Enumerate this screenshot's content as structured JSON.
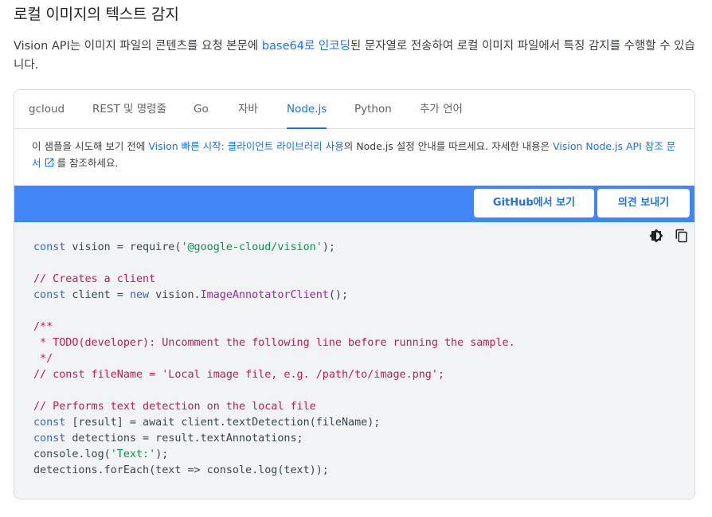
{
  "page": {
    "title": "로컬 이미지의 텍스트 감지",
    "intro": {
      "before": "Vision API는 이미지 파일의 콘텐츠를 요청 본문에 ",
      "link": "base64로 인코딩",
      "after": "된 문자열로 전송하여 로컬 이미지 파일에서 특징 감지를 수행할 수 있습니다."
    }
  },
  "tabs": [
    {
      "label": "gcloud",
      "active": false
    },
    {
      "label": "REST 및 명령줄",
      "active": false
    },
    {
      "label": "Go",
      "active": false
    },
    {
      "label": "자바",
      "active": false
    },
    {
      "label": "Node.js",
      "active": true
    },
    {
      "label": "Python",
      "active": false
    },
    {
      "label": "추가 언어",
      "active": false
    }
  ],
  "note": {
    "t1": "이 샘플을 시도해 보기 전에 ",
    "link1": "Vision 빠른 시작: 클라이언트 라이브러리 사용",
    "t2": "의 Node.js 설정 안내를 따르세요. 자세한 내용은 ",
    "link2": "Vision Node.js API 참조 문서",
    "t3": "를 참조하세요."
  },
  "buttons": {
    "github": "GitHub에서 보기",
    "feedback": "의견 보내기"
  },
  "code_tools": {
    "theme_icon": "dark-mode-toggle-icon",
    "copy_icon": "copy-icon"
  },
  "code": {
    "l1": [
      "const",
      " vision = require(",
      "'@google-cloud/vision'",
      ");"
    ],
    "l3": "// Creates a client",
    "l4": [
      "const",
      " client = ",
      "new",
      " vision.",
      "ImageAnnotatorClient",
      "();"
    ],
    "l6": "/**",
    "l7": " * TODO(developer): Uncomment the following line before running the sample.",
    "l8": " */",
    "l9": "// const fileName = 'Local image file, e.g. /path/to/image.png';",
    "l11": "// Performs text detection on the local file",
    "l12": [
      "const",
      " [result] = await client.textDetection(fileName);"
    ],
    "l13": [
      "const",
      " detections = result.textAnnotations;"
    ],
    "l14": [
      "console.log(",
      "'Text:'",
      ");"
    ],
    "l15": "detections.forEach(text => console.log(text));"
  },
  "colors": {
    "accent": "#1a73e8",
    "bar": "#4285f4",
    "code_bg": "#f1f3f4",
    "keyword": "#3367d6",
    "string": "#0d904f",
    "comment": "#c2185b",
    "class": "#9c27b0"
  }
}
